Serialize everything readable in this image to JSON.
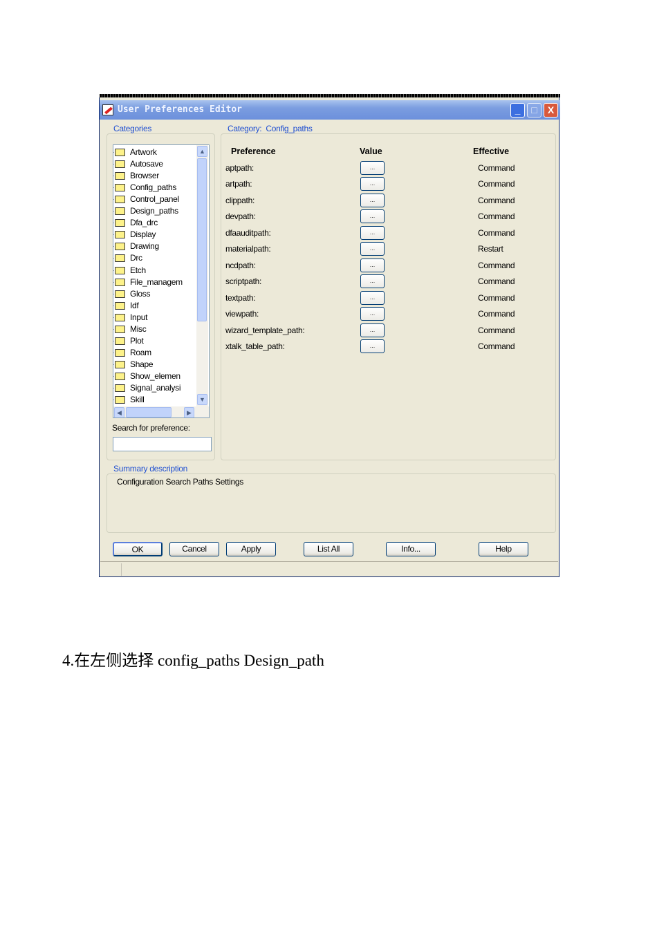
{
  "window": {
    "title": "User Preferences Editor",
    "minimize": "_",
    "maximize": "□",
    "close": "X"
  },
  "categories": {
    "label": "Categories",
    "items": [
      "Artwork",
      "Autosave",
      "Browser",
      "Config_paths",
      "Control_panel",
      "Design_paths",
      "Dfa_drc",
      "Display",
      "Drawing",
      "Drc",
      "Etch",
      "File_managem",
      "Gloss",
      "Idf",
      "Input",
      "Misc",
      "Plot",
      "Roam",
      "Shape",
      "Show_elemen",
      "Signal_analysi",
      "Skill"
    ],
    "search_label": "Search for preference:",
    "search_value": ""
  },
  "category": {
    "label": "Category:",
    "name": "Config_paths",
    "headers": {
      "preference": "Preference",
      "value": "Value",
      "effective": "Effective"
    },
    "value_button": "...",
    "rows": [
      {
        "pref": "aptpath:",
        "effective": "Command"
      },
      {
        "pref": "artpath:",
        "effective": "Command"
      },
      {
        "pref": "clippath:",
        "effective": "Command"
      },
      {
        "pref": "devpath:",
        "effective": "Command"
      },
      {
        "pref": "dfaauditpath:",
        "effective": "Command"
      },
      {
        "pref": "materialpath:",
        "effective": "Restart"
      },
      {
        "pref": "ncdpath:",
        "effective": "Command"
      },
      {
        "pref": "scriptpath:",
        "effective": "Command"
      },
      {
        "pref": "textpath:",
        "effective": "Command"
      },
      {
        "pref": "viewpath:",
        "effective": "Command"
      },
      {
        "pref": "wizard_template_path:",
        "effective": "Command"
      },
      {
        "pref": "xtalk_table_path:",
        "effective": "Command"
      }
    ]
  },
  "summary": {
    "label": "Summary description",
    "text": "Configuration Search Paths Settings"
  },
  "buttons": {
    "ok": "OK",
    "cancel": "Cancel",
    "apply": "Apply",
    "list_all": "List All",
    "info": "Info...",
    "help": "Help"
  },
  "caption": "4.在左侧选择 config_paths Design_path"
}
